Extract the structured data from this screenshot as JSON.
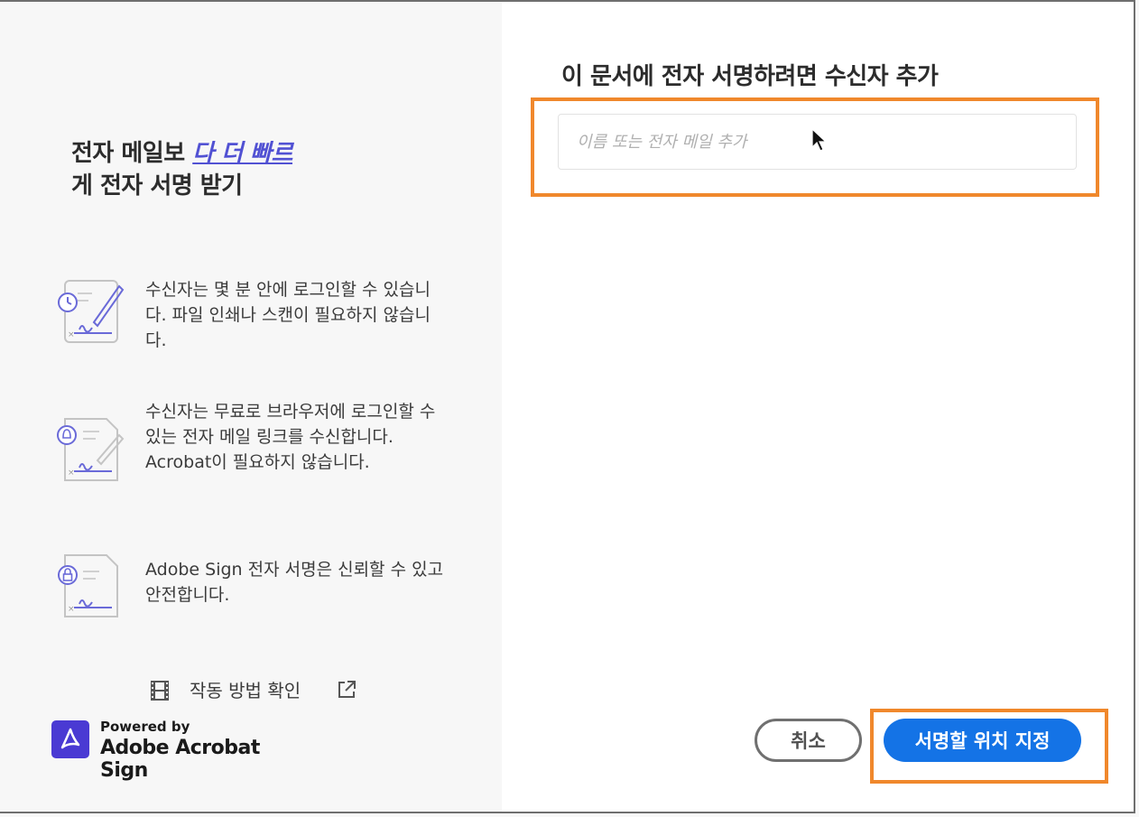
{
  "left": {
    "headline_part1": "전자 메일보 ",
    "headline_link": "다 더 빠르",
    "headline_part2": "게 전자 서명 받기",
    "features": [
      {
        "icon": "clock-signature-icon",
        "text": "수신자는 몇 분 안에 로그인할 수 있습니다. 파일 인쇄나 스캔이 필요하지 않습니다."
      },
      {
        "icon": "bell-signature-icon",
        "text": "수신자는 무료로 브라우저에 로그인할 수 있는 전자 메일 링크를 수신합니다. Acrobat이 필요하지 않습니다."
      },
      {
        "icon": "lock-signature-icon",
        "text": "Adobe Sign 전자 서명은 신뢰할 수 있고 안전합니다."
      }
    ],
    "how_it_works_label": "작동 방법 확인",
    "brand_powered": "Powered by",
    "brand_name": "Adobe Acrobat Sign"
  },
  "right": {
    "title": "이 문서에 전자 서명하려면 수신자 추가",
    "recipient_placeholder": "이름 또는 전자 메일 추가",
    "recipient_value": "",
    "cancel_label": "취소",
    "primary_label": "서명할 위치 지정"
  },
  "colors": {
    "accent": "#1473e6",
    "highlight": "#f0882c",
    "link": "#5151d3",
    "brand": "#4a3ad3"
  }
}
